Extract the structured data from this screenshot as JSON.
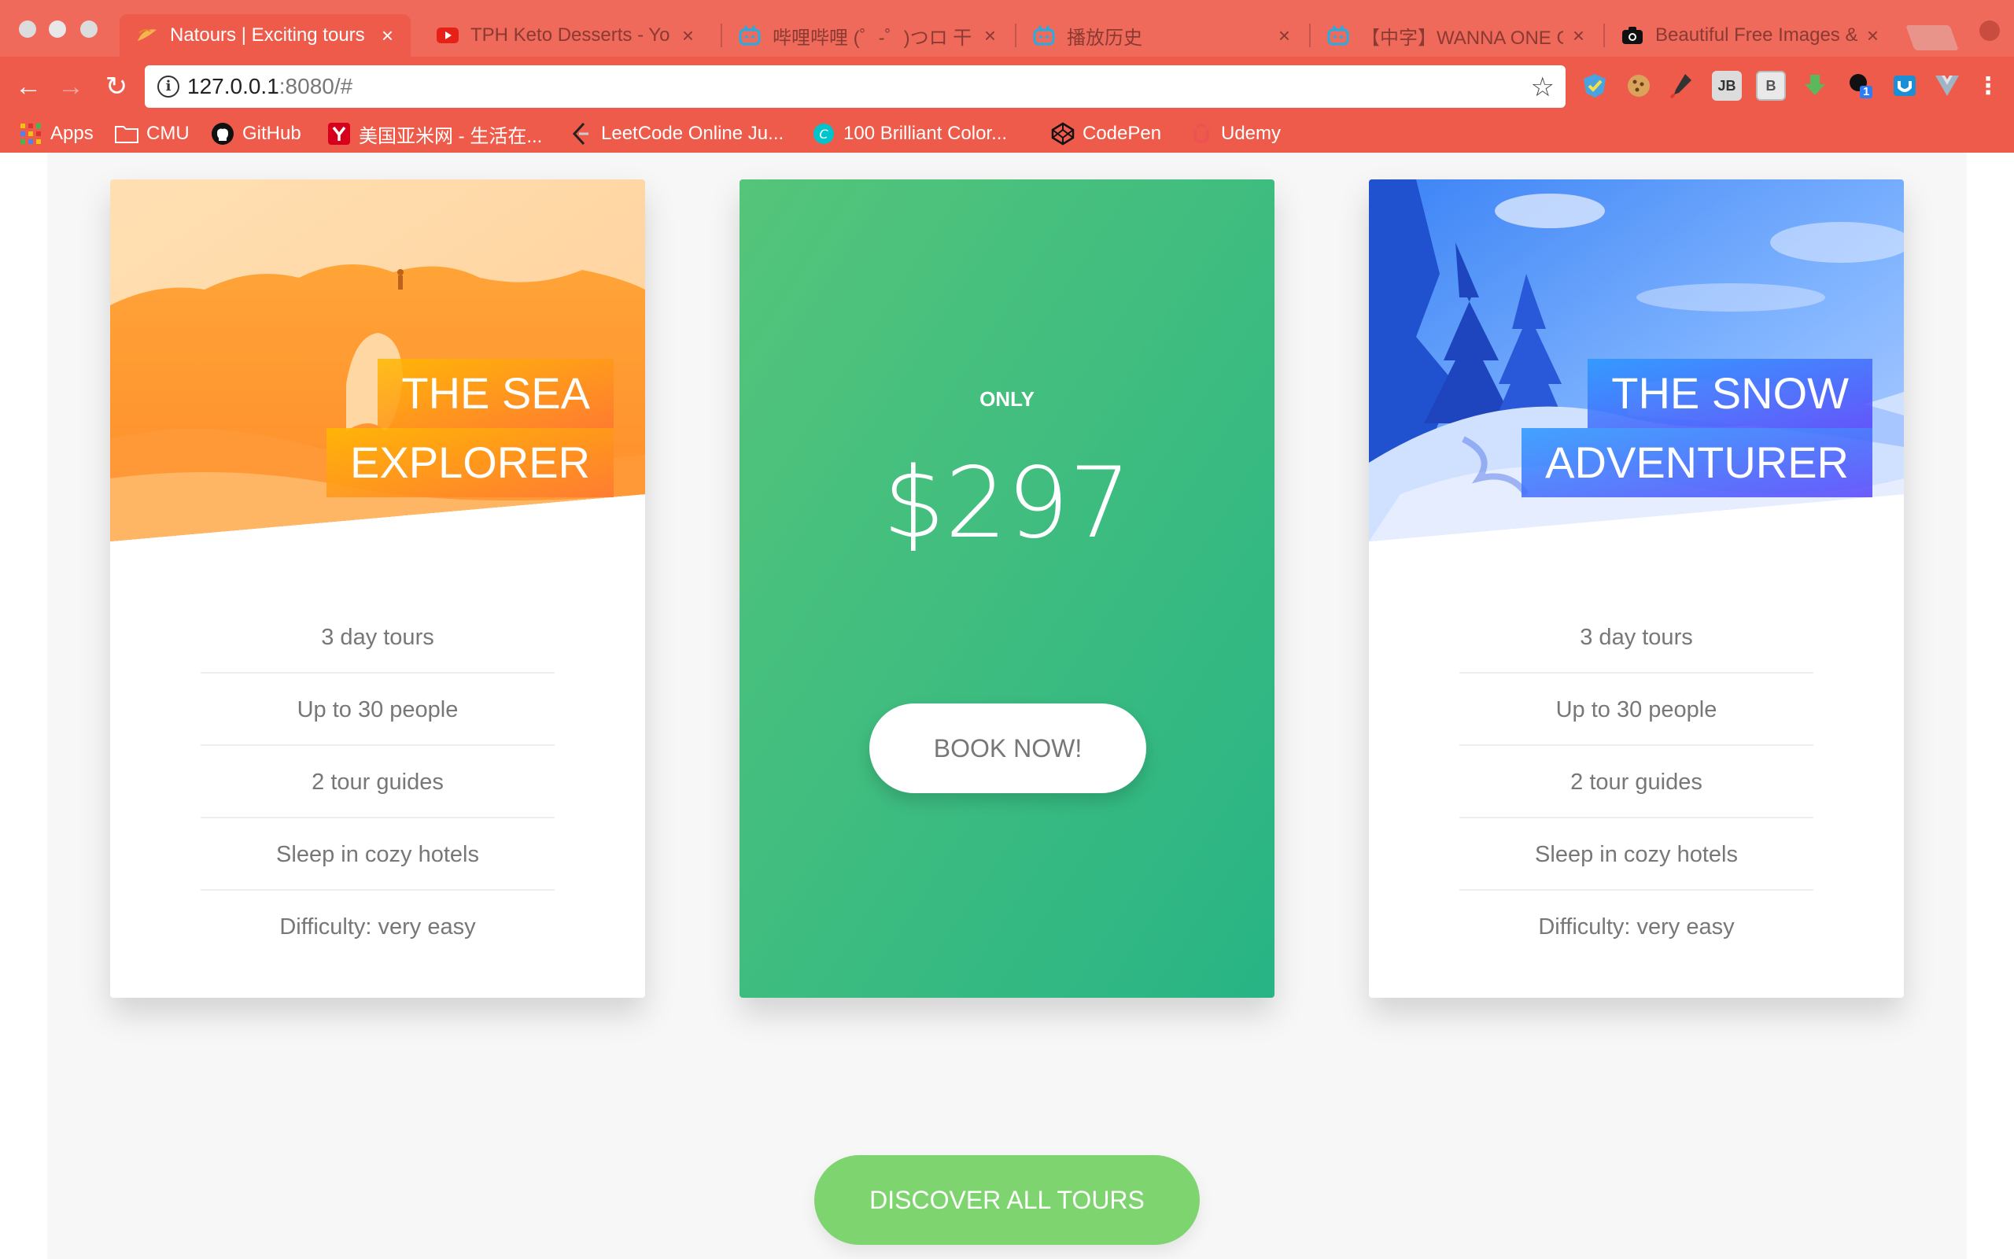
{
  "browser": {
    "tabs": [
      {
        "title": "Natours | Exciting tours",
        "active": true,
        "icon": "natours-leaf-icon"
      },
      {
        "title": "TPH Keto Desserts - Yo",
        "active": false,
        "icon": "youtube-icon"
      },
      {
        "title": "哔哩哔哩 (゜-゜)つロ 干",
        "active": false,
        "icon": "bilibili-icon"
      },
      {
        "title": "播放历史",
        "active": false,
        "icon": "bilibili-icon"
      },
      {
        "title": "【中字】WANNA ONE G",
        "active": false,
        "icon": "bilibili-icon"
      },
      {
        "title": "Beautiful Free Images &",
        "active": false,
        "icon": "camera-icon"
      }
    ],
    "tab_close": "×",
    "url_host": "127.0.0.1",
    "url_rest": ":8080/#",
    "bookmarks": [
      {
        "label": "Apps",
        "icon": "apps-grid-icon"
      },
      {
        "label": "CMU",
        "icon": "folder-icon"
      },
      {
        "label": "GitHub",
        "icon": "github-icon"
      },
      {
        "label": "美国亚米网 - 生活在...",
        "icon": "yamibuy-icon"
      },
      {
        "label": "LeetCode Online Ju...",
        "icon": "leetcode-icon"
      },
      {
        "label": "100 Brilliant Color...",
        "icon": "canva-icon"
      },
      {
        "label": "CodePen",
        "icon": "codepen-icon"
      },
      {
        "label": "Udemy",
        "icon": "udemy-icon"
      }
    ],
    "extensions": [
      "shield-ext-icon",
      "cookie-ext-icon",
      "eyedropper-ext-icon",
      "jb-ext-icon",
      "b-ext-icon",
      "download-ext-icon",
      "badge-ext-icon",
      "pocket-ext-icon",
      "vue-ext-icon",
      "menu-dots-icon"
    ],
    "ext_badge": "1",
    "ext_jb": "JB",
    "ext_b": "B"
  },
  "cards": [
    {
      "heading_line1": "The Sea",
      "heading_line2": "Explorer",
      "theme": "orange",
      "colors": {
        "light": "#ffb900",
        "dark": "#ff7730"
      },
      "details": [
        "3 day tours",
        "Up to 30 people",
        "2 tour guides",
        "Sleep in cozy hotels",
        "Difficulty: very easy"
      ]
    },
    {
      "only_label": "Only",
      "price": "$297",
      "button": "Book now!",
      "colors": {
        "light": "#55c57a",
        "dark": "#28b485"
      }
    },
    {
      "heading_line1": "The Snow",
      "heading_line2": "Adventurer",
      "theme": "blue",
      "colors": {
        "light": "#2998ff",
        "dark": "#5643fa"
      },
      "details": [
        "3 day tours",
        "Up to 30 people",
        "2 tour guides",
        "Sleep in cozy hotels",
        "Difficulty: very easy"
      ]
    }
  ],
  "discover_button": "Discover all tours"
}
